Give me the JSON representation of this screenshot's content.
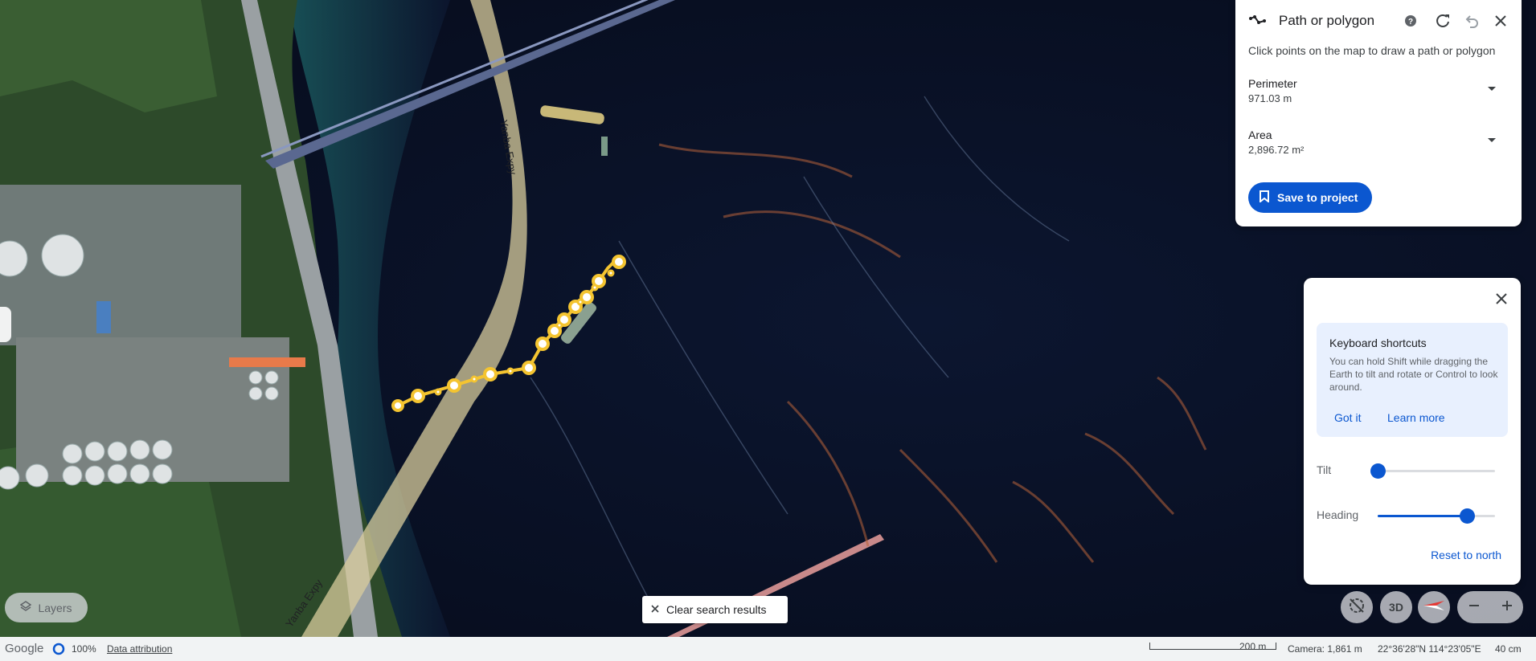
{
  "map": {
    "road_labels": [
      "Yanba Expy",
      "Yanba Expy"
    ]
  },
  "path_panel": {
    "title": "Path or polygon",
    "hint": "Click points on the map to draw a path or polygon",
    "perimeter_label": "Perimeter",
    "perimeter_value": "971.03 m",
    "area_label": "Area",
    "area_value": "2,896.72 m²",
    "save_label": "Save to project",
    "icons": [
      "path-icon",
      "help-icon",
      "refresh-icon",
      "undo-icon",
      "close-icon"
    ]
  },
  "nav_panel": {
    "shortcuts_title": "Keyboard shortcuts",
    "shortcuts_text": "You can hold Shift while dragging the Earth to tilt and rotate or Control to look around.",
    "got_it": "Got it",
    "learn_more": "Learn more",
    "tilt_label": "Tilt",
    "tilt_value": 0,
    "heading_label": "Heading",
    "heading_value": 0.76,
    "reset_label": "Reset to north"
  },
  "controls": {
    "layers_label": "Layers",
    "clear_label": "Clear search results",
    "three_d_label": "3D"
  },
  "status": {
    "logo": "Google",
    "load_percent": "100%",
    "attribution": "Data attribution",
    "scale_label": "200 m",
    "camera": "Camera: 1,861 m",
    "coords": "22°36'28\"N 114°23'05\"E",
    "resolution": "40 cm"
  },
  "colors": {
    "accent": "#0b57d0",
    "path": "#f4c430",
    "water": "#0b1530"
  }
}
